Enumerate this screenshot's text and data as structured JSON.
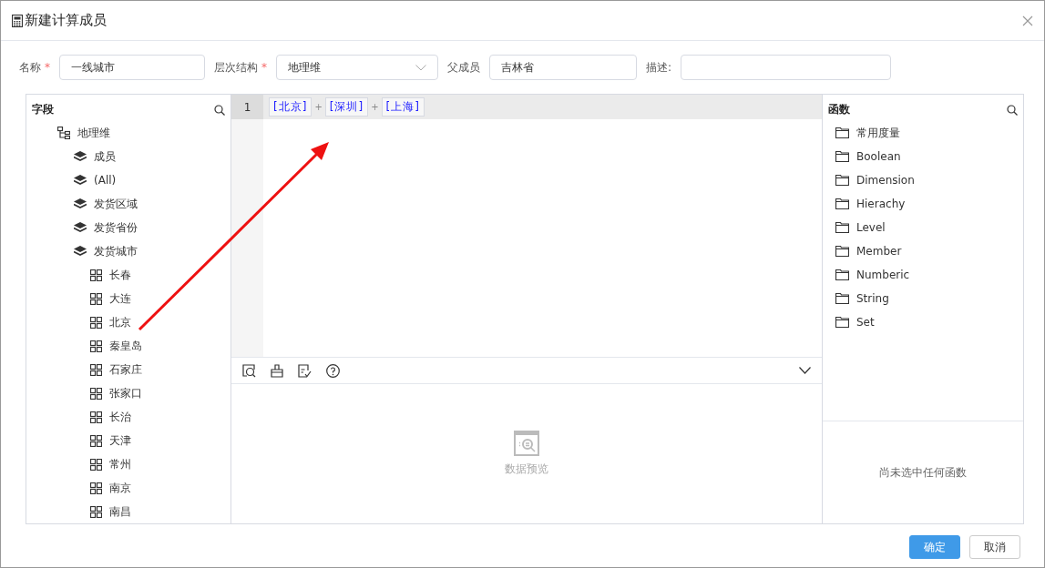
{
  "window": {
    "title": "新建计算成员"
  },
  "form": [
    {
      "label": "名称",
      "required_mark": "*",
      "kind": "input",
      "value": "一线城市"
    },
    {
      "label": "层次结构",
      "required_mark": "*",
      "kind": "select",
      "value": "地理维"
    },
    {
      "label": "父成员",
      "kind": "input",
      "value": "吉林省"
    },
    {
      "label": "描述:",
      "kind": "input"
    }
  ],
  "fields": {
    "title": "字段",
    "tree": [
      {
        "label": "地理维",
        "children": [
          {
            "label": "成员"
          },
          {
            "label": "(All)"
          },
          {
            "label": "发货区域"
          },
          {
            "label": "发货省份"
          },
          {
            "label": "发货城市",
            "children": [
              {
                "label": "长春"
              },
              {
                "label": "大连"
              },
              {
                "label": "北京"
              },
              {
                "label": "秦皇岛"
              },
              {
                "label": "石家庄"
              },
              {
                "label": "张家口"
              },
              {
                "label": "长治"
              },
              {
                "label": "天津"
              },
              {
                "label": "常州"
              },
              {
                "label": "南京"
              },
              {
                "label": "南昌"
              }
            ]
          }
        ]
      }
    ]
  },
  "editor": {
    "line_number": "1",
    "tokens": [
      {
        "kind": "member",
        "text": "[北京]"
      },
      {
        "kind": "operator",
        "text": "+"
      },
      {
        "kind": "member",
        "text": "[深圳]"
      },
      {
        "kind": "operator",
        "text": "+"
      },
      {
        "kind": "member",
        "text": "[上海]"
      }
    ],
    "preview": {
      "text": "数据预览"
    }
  },
  "functions": {
    "title": "函数",
    "items": [
      "常用度量",
      "Boolean",
      "Dimension",
      "Hierachy",
      "Level",
      "Member",
      "Numberic",
      "String",
      "Set"
    ],
    "empty_text": "尚未选中任何函数"
  },
  "buttons": [
    {
      "label": "确定",
      "primary": true
    },
    {
      "label": "取消",
      "primary": false
    }
  ]
}
